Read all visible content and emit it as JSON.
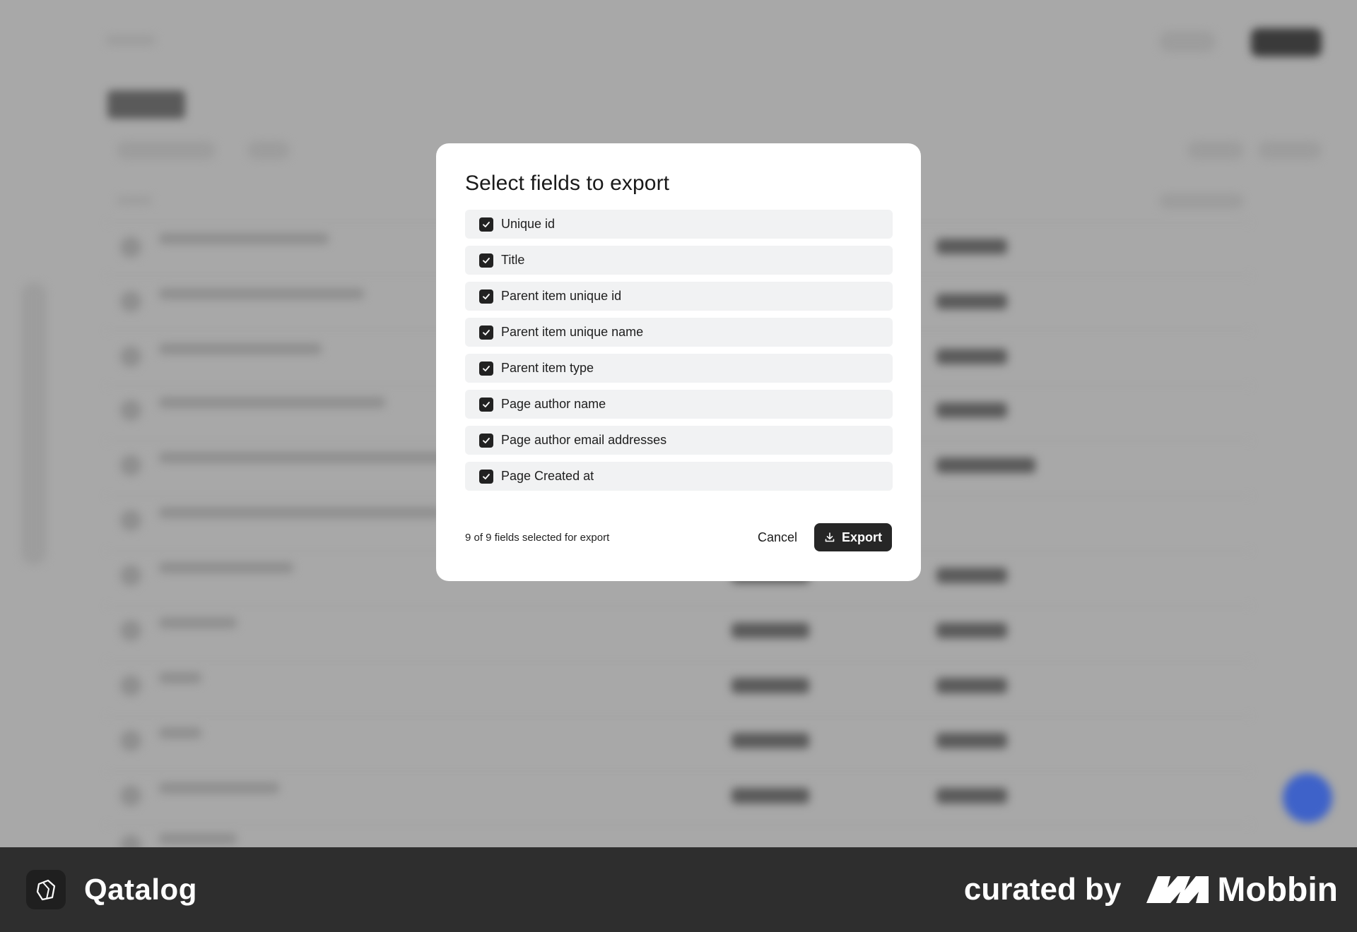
{
  "dialog": {
    "title": "Select fields to export",
    "fields": [
      {
        "label": "Unique id",
        "checked": true
      },
      {
        "label": "Title",
        "checked": true
      },
      {
        "label": "Parent item unique id",
        "checked": true
      },
      {
        "label": "Parent item unique name",
        "checked": true
      },
      {
        "label": "Parent item type",
        "checked": true
      },
      {
        "label": "Page author name",
        "checked": true
      },
      {
        "label": "Page author email addresses",
        "checked": true
      },
      {
        "label": "Page Created at",
        "checked": true
      }
    ],
    "selection_summary": "9 of 9 fields selected for export",
    "cancel_label": "Cancel",
    "export_label": "Export",
    "export_icon": "download-icon"
  },
  "brand_bar": {
    "app_name": "Qatalog",
    "app_icon": "qatalog-logo-icon",
    "curated_by": "curated by",
    "curator": "Mobbin",
    "curator_icon": "mobbin-logo-icon"
  },
  "colors": {
    "overlay": "#a8a8a8",
    "dialog_bg": "#ffffff",
    "field_bg": "#f1f2f3",
    "checkbox": "#222222",
    "primary_button": "#262626",
    "brand_bar": "#2e2e2e",
    "fab": "#3e62c9"
  }
}
